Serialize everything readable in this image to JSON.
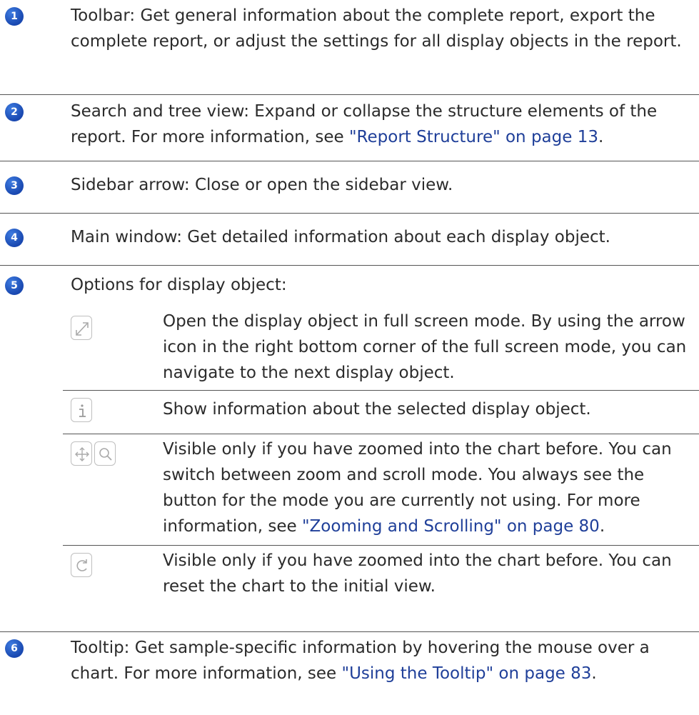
{
  "items": [
    {
      "num": "1",
      "text": "Toolbar: Get general information about the complete report, export the complete report, or adjust the settings for all display objects in the report."
    },
    {
      "num": "2",
      "text_before": "Search and tree view: Expand or collapse the structure elements of the report. For more information, see ",
      "link": "\"Report Structure\" on page 13",
      "text_after": "."
    },
    {
      "num": "3",
      "text": "Sidebar arrow: Close or open the sidebar view."
    },
    {
      "num": "4",
      "text": "Main window: Get detailed information about each display object."
    },
    {
      "num": "5",
      "text": "Options for display object:"
    },
    {
      "num": "6",
      "text_before": "Tooltip: Get sample-specific information by hovering the mouse over a chart. For more information, see ",
      "link": "\"Using the Tooltip\" on page 83",
      "text_after": "."
    }
  ],
  "options": [
    {
      "icon": "fullscreen-icon",
      "text": "Open the display object in full screen mode. By using the arrow icon in the right bottom corner of the full screen mode, you can navigate to the next display object."
    },
    {
      "icon": "info-icon",
      "text": "Show information about the selected display object."
    },
    {
      "icons": [
        "move-icon",
        "zoom-icon"
      ],
      "text_before": "Visible only if you have zoomed into the chart before. You can switch between zoom and scroll mode. You always see the button for the mode you are currently not using. For more information, see ",
      "link": "\"Zooming and Scrolling\" on page 80",
      "text_after": "."
    },
    {
      "icon": "reset-icon",
      "text": "Visible only if you have zoomed into the chart before. You can reset the chart to the initial view."
    }
  ]
}
